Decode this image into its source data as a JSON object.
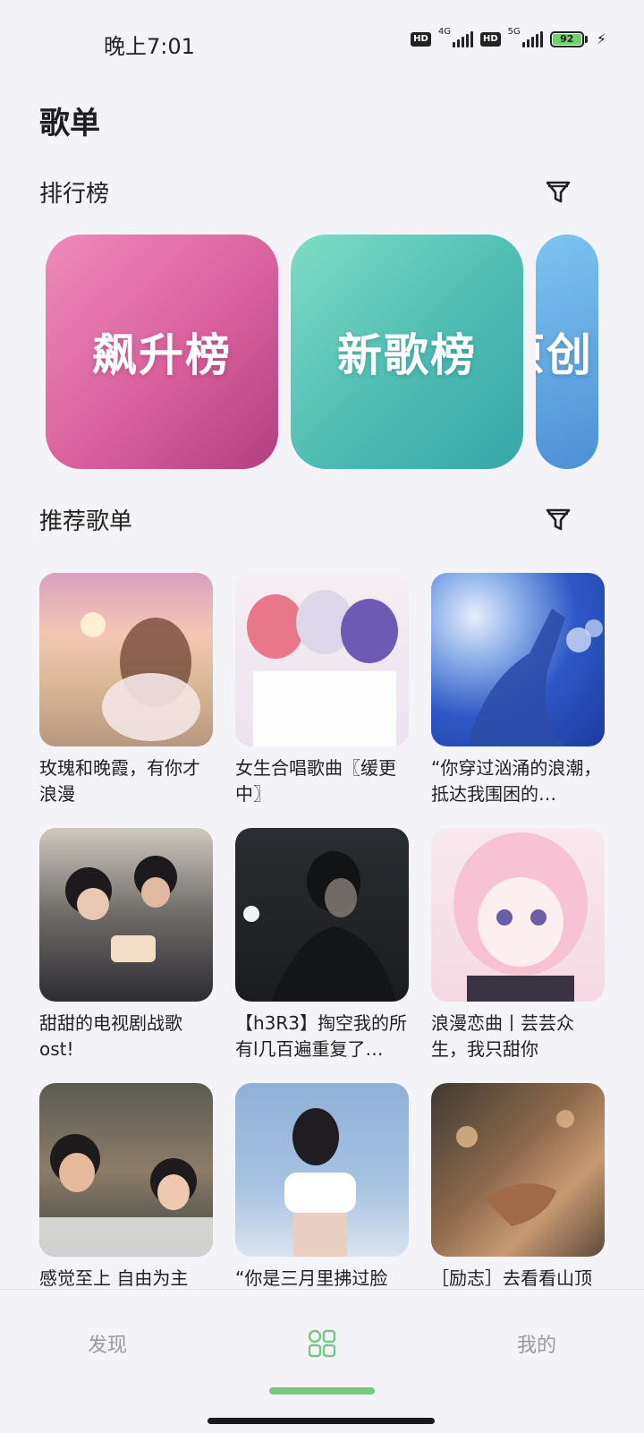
{
  "status_bar": {
    "time": "晚上7:01",
    "hd_label": "HD",
    "net1": "4G",
    "net2": "5G",
    "battery": "92"
  },
  "page_title": "歌单",
  "rankings": {
    "title": "排行榜",
    "cards": [
      "飙升榜",
      "新歌榜",
      "原创"
    ]
  },
  "recommended": {
    "title": "推荐歌单",
    "playlists": [
      {
        "title": "玫瑰和晚霞，有你才浪漫"
      },
      {
        "title": "女生合唱歌曲〖缓更中〗"
      },
      {
        "title": "“你穿过汹涌的浪潮，抵达我围困的…"
      },
      {
        "title": "甜甜的电视剧战歌ost!"
      },
      {
        "title": "【h3R3】掏空我的所有l几百遍重复了…"
      },
      {
        "title": "浪漫恋曲丨芸芸众生，我只甜你"
      },
      {
        "title": "感觉至上 自由为主"
      },
      {
        "title": "“你是三月里拂过脸"
      },
      {
        "title": "［励志］去看看山顶"
      }
    ]
  },
  "bottom_nav": {
    "discover": "发现",
    "mine": "我的"
  },
  "colors": {
    "accent": "#74c983",
    "background": "#f4f4f8"
  }
}
